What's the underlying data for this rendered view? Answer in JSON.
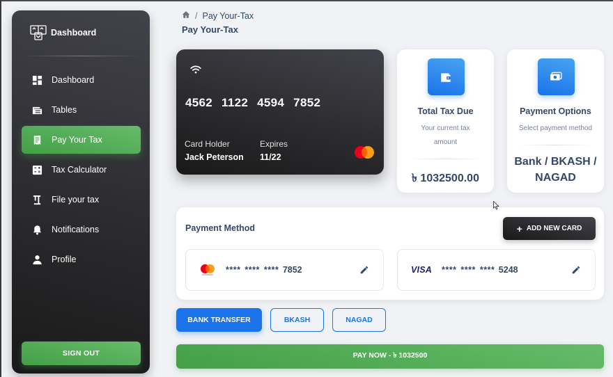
{
  "sidebar": {
    "brand": "Dashboard",
    "items": [
      {
        "label": "Dashboard",
        "icon": "dashboard-icon"
      },
      {
        "label": "Tables",
        "icon": "table-icon"
      },
      {
        "label": "Pay Your Tax",
        "icon": "receipt-icon",
        "active": true
      },
      {
        "label": "Tax Calculator",
        "icon": "calculator-icon"
      },
      {
        "label": "File your tax",
        "icon": "file-icon"
      },
      {
        "label": "Notifications",
        "icon": "bell-icon"
      },
      {
        "label": "Profile",
        "icon": "person-icon"
      }
    ],
    "signout_label": "SIGN OUT"
  },
  "header": {
    "breadcrumb_current": "Pay Your-Tax",
    "page_title": "Pay Your-Tax"
  },
  "credit_card": {
    "number": "4562 1122 4594 7852",
    "holder_label": "Card Holder",
    "holder_name": "Jack Peterson",
    "expires_label": "Expires",
    "expires_value": "11/22"
  },
  "tax_due": {
    "title": "Total Tax Due",
    "subtitle": "Your current tax amount",
    "amount": "৳ 1032500.00"
  },
  "payment_options": {
    "title": "Payment Options",
    "subtitle": "Select payment method",
    "methods": "Bank / BKASH / NAGAD"
  },
  "payment_method": {
    "title": "Payment Method",
    "add_card_label": "ADD NEW CARD",
    "cards": [
      {
        "brand": "mastercard",
        "masked": "**** **** ****",
        "last4": "7852"
      },
      {
        "brand": "VISA",
        "masked": "**** **** ****",
        "last4": "5248"
      }
    ]
  },
  "method_buttons": [
    {
      "label": "BANK TRANSFER",
      "selected": true
    },
    {
      "label": "BKASH",
      "selected": false
    },
    {
      "label": "NAGAD",
      "selected": false
    }
  ],
  "pay_now_label": "PAY NOW - ৳ 1032500",
  "colors": {
    "primary": "#1a73e8",
    "success": "#4caf50",
    "dark": "#191919",
    "text": "#344767"
  }
}
